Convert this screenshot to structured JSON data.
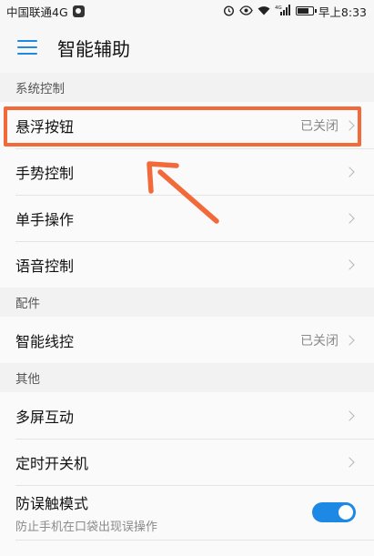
{
  "status_bar": {
    "carrier": "中国联通4G",
    "network": "4G",
    "time": "早上8:33",
    "icons": [
      "alarm-icon",
      "eye-icon",
      "wifi-icon",
      "signal-icon",
      "battery-icon"
    ],
    "battery_level": 0.75
  },
  "app_bar": {
    "title": "智能辅助",
    "menu_icon": "hamburger-menu-icon",
    "accent": "#1e88e5"
  },
  "sections": [
    {
      "header": "系统控制",
      "items": [
        {
          "label": "悬浮按钮",
          "value": "已关闭"
        },
        {
          "label": "手势控制"
        },
        {
          "label": "单手操作"
        },
        {
          "label": "语音控制"
        }
      ]
    },
    {
      "header": "配件",
      "items": [
        {
          "label": "智能线控",
          "value": "已关闭"
        }
      ]
    },
    {
      "header": "其他",
      "items": [
        {
          "label": "多屏互动"
        },
        {
          "label": "定时开关机"
        },
        {
          "label": "防误触模式",
          "subtitle": "防止手机在口袋出现误操作",
          "toggle_on": true
        }
      ]
    }
  ],
  "annotation": {
    "color": "#f26a3a"
  }
}
